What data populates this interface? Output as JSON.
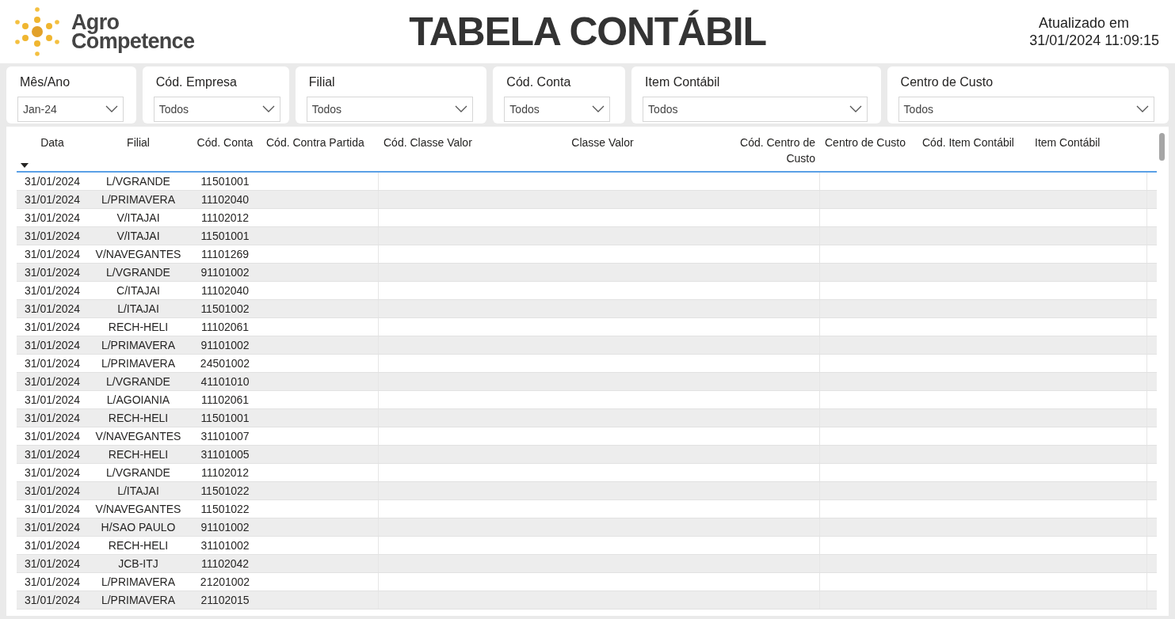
{
  "logo": {
    "line_1": "Agro",
    "line_2": "Competence"
  },
  "title": "TABELA CONTÁBIL",
  "updated": {
    "label": "Atualizado em",
    "timestamp": "31/01/2024 11:09:15"
  },
  "filters": [
    {
      "label": "Mês/Ano",
      "value": "Jan-24"
    },
    {
      "label": "Cód. Empresa",
      "value": "Todos"
    },
    {
      "label": "Filial",
      "value": "Todos"
    },
    {
      "label": "Cód. Conta",
      "value": "Todos"
    },
    {
      "label": "Item Contábil",
      "value": "Todos"
    },
    {
      "label": "Centro de Custo",
      "value": "Todos"
    }
  ],
  "table": {
    "columns": [
      {
        "label": "Data",
        "sorted": true
      },
      {
        "label": "Filial",
        "sorted": false
      },
      {
        "label": "Cód. Conta",
        "sorted": false
      },
      {
        "label": "Cód. Contra Partida",
        "sorted": false
      },
      {
        "label": "Cód. Classe Valor",
        "sorted": false
      },
      {
        "label": "Classe Valor",
        "sorted": false
      },
      {
        "label": "Cód. Centro de Custo",
        "sorted": false
      },
      {
        "label": "Centro de Custo",
        "sorted": false
      },
      {
        "label": "Cód. Item Contábil",
        "sorted": false
      },
      {
        "label": "Item Contábil",
        "sorted": false
      }
    ],
    "rows": [
      [
        "31/01/2024",
        "L/VGRANDE",
        "11501001"
      ],
      [
        "31/01/2024",
        "L/PRIMAVERA",
        "11102040"
      ],
      [
        "31/01/2024",
        "V/ITAJAI",
        "11102012"
      ],
      [
        "31/01/2024",
        "V/ITAJAI",
        "11501001"
      ],
      [
        "31/01/2024",
        "V/NAVEGANTES",
        "11101269"
      ],
      [
        "31/01/2024",
        "L/VGRANDE",
        "91101002"
      ],
      [
        "31/01/2024",
        "C/ITAJAI",
        "11102040"
      ],
      [
        "31/01/2024",
        "L/ITAJAI",
        "11501002"
      ],
      [
        "31/01/2024",
        "RECH-HELI",
        "11102061"
      ],
      [
        "31/01/2024",
        "L/PRIMAVERA",
        "91101002"
      ],
      [
        "31/01/2024",
        "L/PRIMAVERA",
        "24501002"
      ],
      [
        "31/01/2024",
        "L/VGRANDE",
        "41101010"
      ],
      [
        "31/01/2024",
        "L/AGOIANIA",
        "11102061"
      ],
      [
        "31/01/2024",
        "RECH-HELI",
        "11501001"
      ],
      [
        "31/01/2024",
        "V/NAVEGANTES",
        "31101007"
      ],
      [
        "31/01/2024",
        "RECH-HELI",
        "31101005"
      ],
      [
        "31/01/2024",
        "L/VGRANDE",
        "11102012"
      ],
      [
        "31/01/2024",
        "L/ITAJAI",
        "11501022"
      ],
      [
        "31/01/2024",
        "V/NAVEGANTES",
        "11501022"
      ],
      [
        "31/01/2024",
        "H/SAO PAULO",
        "91101002"
      ],
      [
        "31/01/2024",
        "RECH-HELI",
        "31101002"
      ],
      [
        "31/01/2024",
        "JCB-ITJ",
        "11102042"
      ],
      [
        "31/01/2024",
        "L/PRIMAVERA",
        "21201002"
      ],
      [
        "31/01/2024",
        "L/PRIMAVERA",
        "21102015"
      ]
    ]
  }
}
